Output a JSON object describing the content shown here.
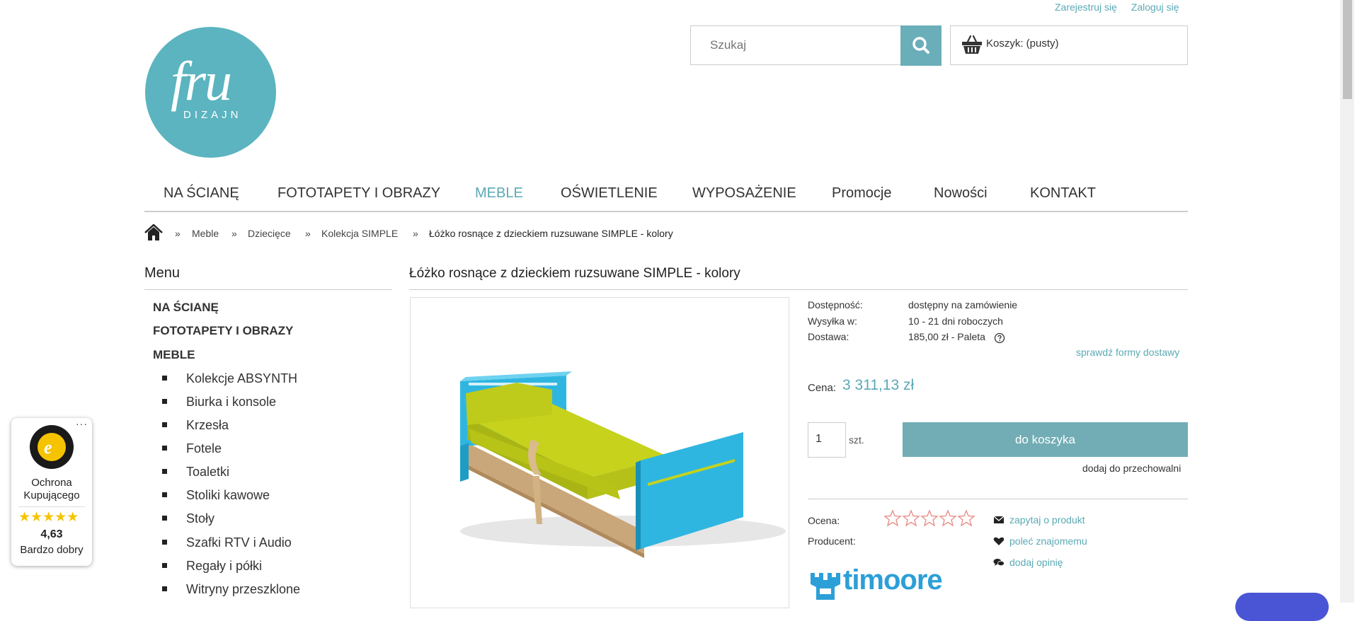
{
  "top_links": {
    "register": "Zarejestruj się",
    "login": "Zaloguj się"
  },
  "logo": {
    "script": "fru",
    "word": "DIZAJN"
  },
  "search": {
    "placeholder": "Szukaj"
  },
  "cart": {
    "label": "Koszyk: (pusty)"
  },
  "nav": {
    "items": [
      {
        "label": "NA ŚCIANĘ"
      },
      {
        "label": "FOTOTAPETY I OBRAZY"
      },
      {
        "label": "MEBLE"
      },
      {
        "label": "OŚWIETLENIE"
      },
      {
        "label": "WYPOSAŻENIE"
      },
      {
        "label": "Promocje"
      },
      {
        "label": "Nowości"
      },
      {
        "label": "KONTAKT"
      }
    ],
    "active": "MEBLE"
  },
  "breadcrumb": {
    "sep": "»",
    "items": [
      "Meble",
      "Dziecięce",
      "Kolekcja SIMPLE",
      "Łóżko rosnące z dzieckiem ruzsuwane SIMPLE - kolory"
    ]
  },
  "sidebar": {
    "title": "Menu",
    "top_items": [
      "NA ŚCIANĘ",
      "FOTOTAPETY I OBRAZY",
      "MEBLE"
    ],
    "sub_items": [
      "Kolekcje ABSYNTH",
      "Biurka i konsole",
      "Krzesła",
      "Fotele",
      "Toaletki",
      "Stoliki kawowe",
      "Stoły",
      "Szafki RTV i Audio",
      "Regały i półki",
      "Witryny przeszklone"
    ]
  },
  "product": {
    "title": "Łóżko rosnące z dzieckiem ruzsuwane SIMPLE - kolory",
    "availability_label": "Dostępność:",
    "availability": "dostępny na zamówienie",
    "shipping_label": "Wysyłka w:",
    "shipping": "10 - 21 dni roboczych",
    "delivery_label": "Dostawa:",
    "delivery": "185,00 zł - Paleta",
    "delivery_forms_link": "sprawdź formy dostawy",
    "price_label": "Cena:",
    "price": "3 311,13 zł",
    "qty": "1",
    "unit": "szt.",
    "add_to_cart": "do koszyka",
    "add_to_wishlist": "dodaj do przechowalni",
    "rating_label": "Ocena:",
    "rating_stars": 0,
    "producer_label": "Producent:",
    "producer": "timoore",
    "actions": [
      "zapytaj o produkt",
      "poleć znajomemu",
      "dodaj opinię"
    ]
  },
  "trusted_shops": {
    "line1": "Ochrona",
    "line2": "Kupującego",
    "stars": "★★★★★",
    "rating": "4,63",
    "verdict": "Bardzo dobry",
    "more": "···"
  },
  "colors": {
    "accent": "#5aa9b4",
    "button": "#72adb5",
    "star_empty": "#e8908a"
  }
}
